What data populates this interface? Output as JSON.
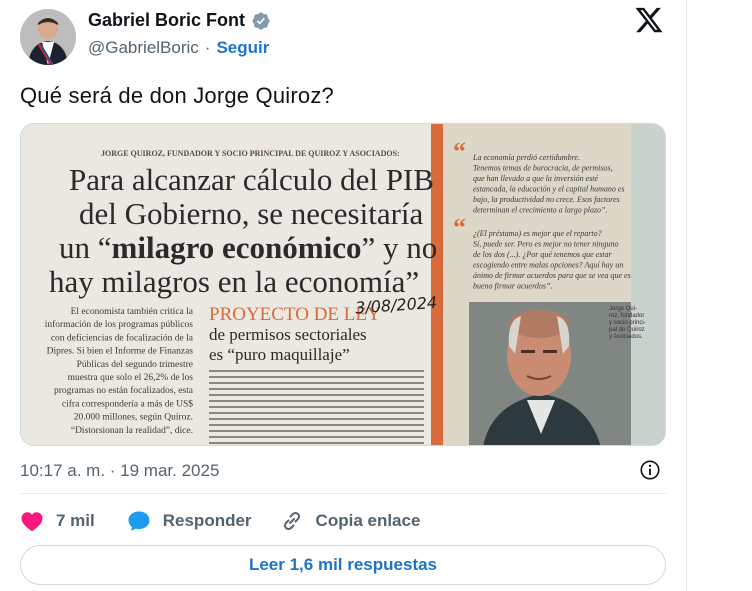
{
  "author": {
    "display_name": "Gabriel Boric Font",
    "handle": "@GabrielBoric",
    "separator": "·",
    "follow_label": "Seguir"
  },
  "tweet": {
    "text": "Qué será de don Jorge Quiroz?",
    "timestamp": "10:17 a. m. · 19 mar. 2025"
  },
  "media": {
    "kicker": "JORGE QUIROZ, FUNDADOR Y SOCIO PRINCIPAL DE QUIROZ Y ASOCIADOS:",
    "headline_1": "Para alcanzar cálculo del PIB",
    "headline_2": "del Gobierno, se necesitaría",
    "headline_3a": "un “",
    "headline_3b": "milagro económico",
    "headline_3c": "” y no",
    "headline_4": "hay milagros en la economía”",
    "handwritten_date": "3/08/2024",
    "section_title": "PROYECTO DE LEY",
    "section_sub_1": "de permisos sectoriales",
    "section_sub_2": "es “puro maquillaje”",
    "col_left": [
      "El economista también critica la",
      "información de los programas públicos",
      "con deficiencias de focalización de la",
      "Dipres. Si bien el Informe de Finanzas",
      "Públicas del segundo trimestre",
      "muestra que solo el 26,2% de los",
      "programas no están focalizados, esta",
      "cifra correspondería a más de US$",
      "20.000 millones, según Quiroz.",
      "“Distorsionan la realidad”, dice."
    ],
    "quote_1": [
      "La economía perdió certidumbre.",
      "Tenemos temas de burocracia, de permisos,",
      "que han llevado a que la inversión esté",
      "estancada, la educación y el capital humano es",
      "bajo, la productividad no crece. Esos factores",
      "determinan el crecimiento a largo plazo”."
    ],
    "quote_2": [
      "¿(El préstamo) es mejor que el reparto?",
      "Sí, puede ser. Pero es mejor no tener ninguno",
      "de los dos (...). ¿Por qué tenemos que estar",
      "escogiendo entre malas opciones? Aquí hay un",
      "ánimo de firmar acuerdos para que se vea que es",
      "bueno firmar acuerdos”."
    ],
    "photo_caption": [
      "Jorge Qui-",
      "roz, fundador",
      "y socio princi-",
      "pal de Quiroz",
      "y Asociados."
    ]
  },
  "actions": {
    "likes": "7 mil",
    "reply_label": "Responder",
    "copy_label": "Copia enlace",
    "read_replies": "Leer 1,6 mil respuestas"
  },
  "icons": [
    "verified-badge-icon",
    "x-logo-icon",
    "info-icon",
    "heart-icon",
    "reply-bubble-icon",
    "link-icon"
  ],
  "colors": {
    "accent": "#1d75c9",
    "like": "#f91880",
    "secondary": "#536471"
  }
}
